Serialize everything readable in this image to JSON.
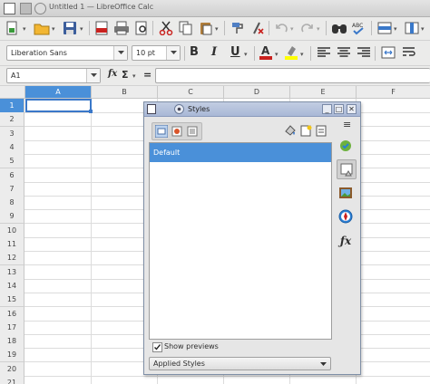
{
  "window": {
    "title": "Untitled 1 — LibreOffice Calc"
  },
  "formatting": {
    "font_name": "Liberation Sans",
    "font_size": "10 pt",
    "bold": "B",
    "italic": "I",
    "underline": "U"
  },
  "formula_bar": {
    "cell_ref": "A1",
    "fx": "fx",
    "sigma": "Σ",
    "equals": "=",
    "value": ""
  },
  "columns": [
    "A",
    "B",
    "C",
    "D",
    "E",
    "F"
  ],
  "rows": [
    "1",
    "2",
    "3",
    "4",
    "5",
    "6",
    "7",
    "8",
    "9",
    "10",
    "11",
    "12",
    "13",
    "14",
    "15",
    "16",
    "17",
    "18",
    "19",
    "20",
    "21"
  ],
  "selected_cell": "A1",
  "styles_panel": {
    "title": "Styles",
    "selected_style": "Default",
    "show_previews_label": "Show previews",
    "show_previews_checked": true,
    "filter_value": "Applied Styles"
  },
  "colors": {
    "selection": "#4a90d9",
    "panel_title": "#b4c1dc",
    "font_color_bar": "#c9211e",
    "highlight_bar": "#ffff00"
  }
}
